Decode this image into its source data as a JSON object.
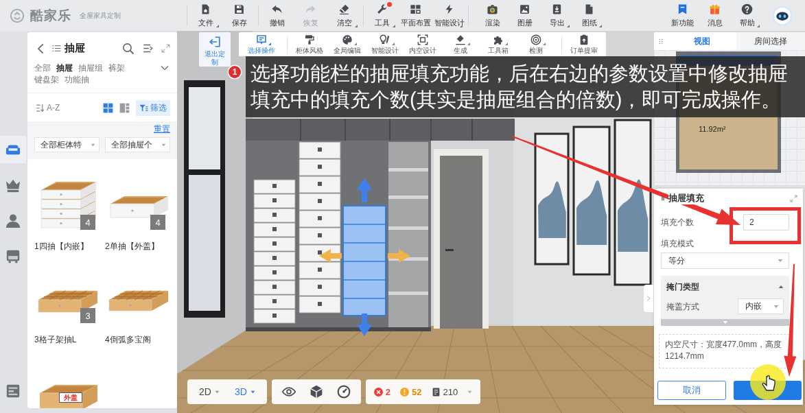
{
  "top_bar": {
    "logo": "酷家乐",
    "tagline": "全屋家具定制",
    "tool_groups": [
      [
        {
          "label": "文件",
          "menu": true,
          "disabled": false,
          "notice": false
        },
        {
          "label": "保存",
          "menu": false,
          "disabled": false,
          "notice": false
        }
      ],
      [
        {
          "label": "撤销",
          "menu": false,
          "disabled": false,
          "notice": false
        },
        {
          "label": "恢复",
          "menu": false,
          "disabled": true,
          "notice": false
        },
        {
          "label": "清空",
          "menu": true,
          "disabled": false,
          "notice": false
        }
      ],
      [
        {
          "label": "工具",
          "menu": true,
          "disabled": false,
          "notice": true
        },
        {
          "label": "平面布置",
          "menu": false,
          "disabled": false,
          "notice": false
        },
        {
          "label": "智能设计",
          "menu": true,
          "disabled": false,
          "notice": false
        }
      ],
      [
        {
          "label": "渲染",
          "menu": false,
          "disabled": false,
          "notice": false
        },
        {
          "label": "图册",
          "menu": false,
          "disabled": false,
          "notice": false
        },
        {
          "label": "导出",
          "menu": true,
          "disabled": false,
          "notice": false
        },
        {
          "label": "图纸",
          "menu": true,
          "disabled": false,
          "notice": false
        }
      ]
    ],
    "right_tools": [
      {
        "label": "新功能",
        "menu": false
      },
      {
        "label": "消息",
        "menu": false
      },
      {
        "label": "帮助",
        "menu": true
      }
    ]
  },
  "rail": {
    "items": [
      {
        "selected": true
      },
      {
        "selected": false
      },
      {
        "selected": false
      },
      {
        "selected": false
      },
      {
        "selected": false
      }
    ]
  },
  "library": {
    "title": "抽屉",
    "categories": [
      {
        "label": "全部",
        "selected": false
      },
      {
        "label": "抽屉",
        "selected": true
      },
      {
        "label": "抽屉组",
        "selected": false
      },
      {
        "label": "裤架",
        "selected": false
      },
      {
        "label": "键盘架",
        "selected": false
      },
      {
        "label": "功能抽",
        "selected": false
      }
    ],
    "sort_label": "A-Z",
    "view_modes": [
      {
        "selected": true
      },
      {
        "selected": false
      }
    ],
    "filter_button": {
      "label": "筛选",
      "on": true
    },
    "reset_link": "重置",
    "filters": [
      {
        "value": "全部柜体特"
      },
      {
        "value": "全部抽屉个"
      }
    ],
    "products": [
      {
        "name": "1四抽【内嵌】",
        "count": "4"
      },
      {
        "name": "2单抽【外盖】",
        "count": "4"
      },
      {
        "name": "3格子架抽L",
        "count": "3"
      },
      {
        "name": "4倒弧多宝阁"
      },
      {
        "tag": "外盖"
      }
    ]
  },
  "custom_toolbar": {
    "exit_button": "退出定制",
    "tool_groups": [
      [
        {
          "label": "选择操作",
          "selected": true,
          "menu": true
        }
      ],
      [
        {
          "label": "柜体风格",
          "selected": false,
          "menu": false
        },
        {
          "label": "全局编辑",
          "selected": false,
          "menu": true
        },
        {
          "label": "智能设计",
          "selected": false,
          "menu": true
        },
        {
          "label": "内空设计",
          "selected": false,
          "menu": false
        },
        {
          "label": "生成",
          "selected": false,
          "menu": true
        },
        {
          "label": "工具箱",
          "selected": false,
          "menu": true
        },
        {
          "label": "检测",
          "selected": false,
          "menu": true
        }
      ],
      [
        {
          "label": "订单提审",
          "selected": false,
          "menu": false
        }
      ]
    ]
  },
  "caption": {
    "step": "1",
    "text": "选择功能栏的抽屉填充功能，后在右边的参数设置中修改抽屉填充中的填充个数(其实是抽屉组合的倍数)，即可完成操作。"
  },
  "view_panel": {
    "tabs": [
      {
        "label": "视图",
        "selected": true
      },
      {
        "label": "房间选择",
        "selected": false
      }
    ],
    "room_area": "11.92m²"
  },
  "properties": {
    "title": "抽屉填充",
    "fields": [
      {
        "kind": "input",
        "label": "填充个数",
        "value": "2",
        "highlighted": true
      },
      {
        "kind": "select",
        "label": "填充模式",
        "value": "等分",
        "highlighted": false
      }
    ],
    "section": {
      "title": "掩门类型",
      "expanded": true,
      "fields": [
        {
          "label": "掩盖方式",
          "value": "内嵌"
        }
      ]
    },
    "info": [
      "内空尺寸：宽度477.0mm，高度1214.7mm"
    ],
    "buttons": [
      {
        "kind": "secondary",
        "label": "取消",
        "clicked": false
      },
      {
        "kind": "primary",
        "clicked": true
      }
    ]
  },
  "bottom_toolbar": {
    "modes": [
      {
        "label": "2D",
        "selected": false
      },
      {
        "label": "3D",
        "selected": true
      }
    ],
    "errors": "2",
    "warnings": "52",
    "items": "210"
  }
}
